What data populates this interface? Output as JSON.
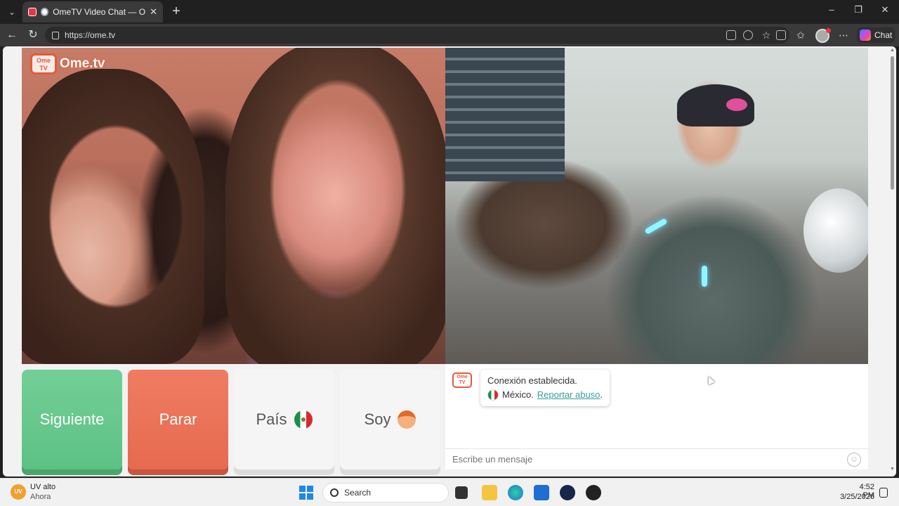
{
  "browser": {
    "tab_title": "OmeTV Video Chat — Omegle",
    "url": "https://ome.tv",
    "chat_button_label": "Chat"
  },
  "page": {
    "logo_badge": "Ome TV",
    "logo_text": "Ome.tv",
    "buttons": {
      "next": "Siguiente",
      "stop": "Parar",
      "country": "País",
      "gender": "Soy"
    },
    "chat": {
      "logo_badge": "Ome TV",
      "status_line": "Conexión establecida.",
      "country_name": "México.",
      "report_link": "Reportar abuso",
      "report_suffix": ".",
      "input_placeholder": "Escribe un mensaje"
    }
  },
  "taskbar": {
    "weather_badge": "UV",
    "weather_title": "UV alto",
    "weather_sub": "Ahora",
    "search_label": "Search",
    "time": "4:52 PM",
    "date": "3/25/2026"
  }
}
